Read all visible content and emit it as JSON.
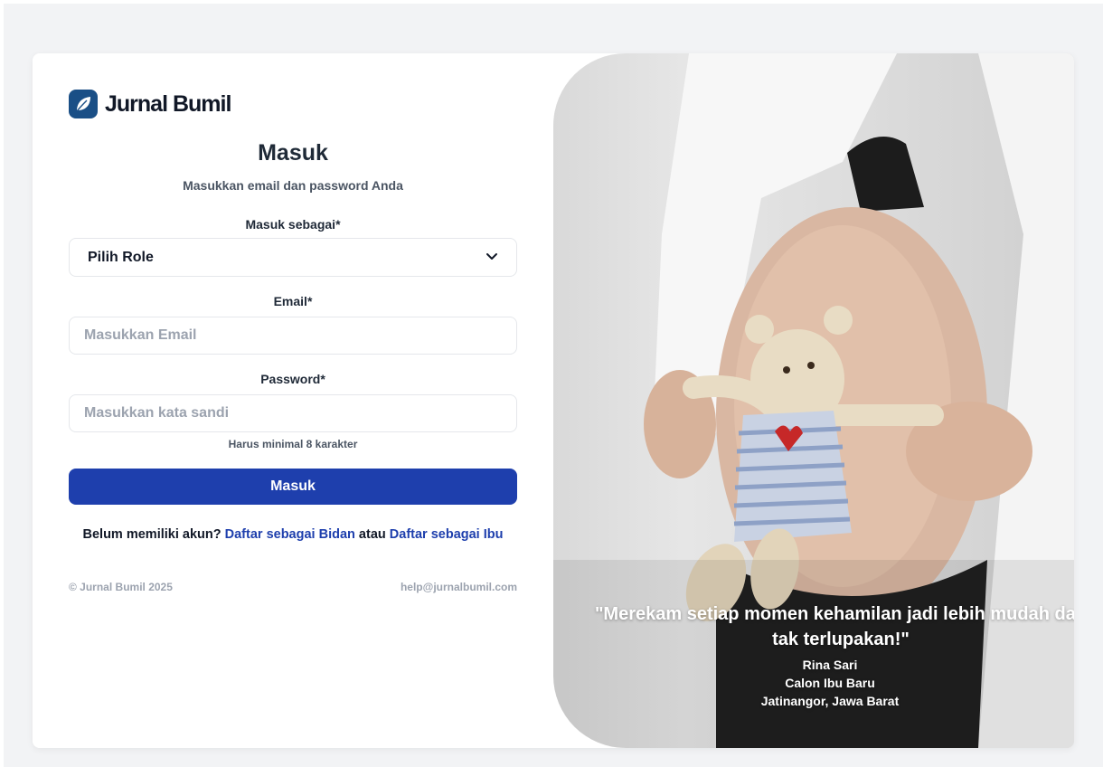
{
  "brand": {
    "name": "Jurnal Bumil",
    "color": "#1a4f86",
    "logo_icon": "leaf-icon"
  },
  "login": {
    "title": "Masuk",
    "subtitle": "Masukkan email dan password Anda",
    "role_label": "Masuk sebagai*",
    "role_selected": "Pilih Role",
    "email_label": "Email*",
    "email_placeholder": "Masukkan Email",
    "password_label": "Password*",
    "password_placeholder": "Masukkan kata sandi",
    "password_hint": "Harus minimal 8 karakter",
    "submit_label": "Masuk",
    "submit_color": "#1e3fad"
  },
  "signup": {
    "prompt": "Belum memiliki akun?",
    "bidan_link": "Daftar sebagai Bidan",
    "separator": "atau",
    "ibu_link": "Daftar sebagai Ibu"
  },
  "footer": {
    "copyright": "© Jurnal Bumil 2025",
    "email": "help@jurnalbumil.com"
  },
  "testimonial": {
    "quote_line1": "\"Merekam setiap momen kehamilan jadi lebih mudah dan",
    "quote_line2": "tak terlupakan!\"",
    "name": "Rina Sari",
    "role": "Calon Ibu Baru",
    "location": "Jatinangor, Jawa Barat"
  }
}
